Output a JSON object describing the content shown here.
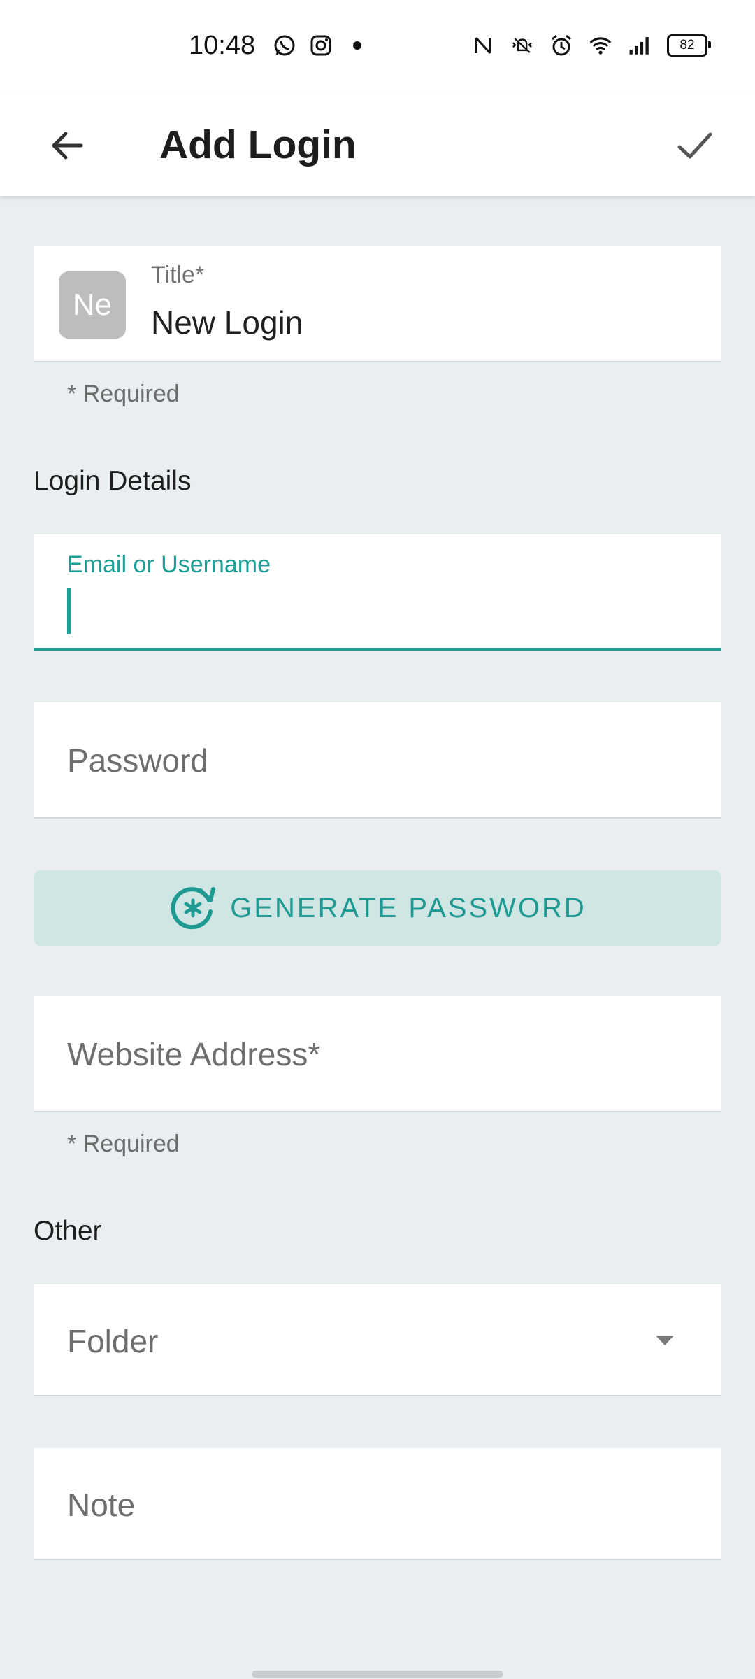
{
  "status_bar": {
    "time": "10:48",
    "battery": "82",
    "left_icons": [
      "whatsapp-icon",
      "instagram-icon",
      "dot-icon"
    ],
    "right_icons": [
      "nfc-icon",
      "vibrate-icon",
      "alarm-icon",
      "wifi-icon",
      "signal-icon",
      "battery-icon"
    ]
  },
  "app_bar": {
    "title": "Add Login"
  },
  "title_field": {
    "avatar_text": "Ne",
    "label": "Title*",
    "value": "New Login",
    "helper": "* Required"
  },
  "login_details": {
    "heading": "Login Details",
    "email_label": "Email or Username",
    "email_value": "",
    "password_placeholder": "Password",
    "generate_button": "GENERATE PASSWORD",
    "website_placeholder": "Website Address*",
    "website_helper": "* Required"
  },
  "other": {
    "heading": "Other",
    "folder_placeholder": "Folder",
    "note_placeholder": "Note"
  },
  "colors": {
    "accent": "#1a9e96",
    "background": "#e9eef0",
    "button_bg": "#cfe6e4"
  }
}
